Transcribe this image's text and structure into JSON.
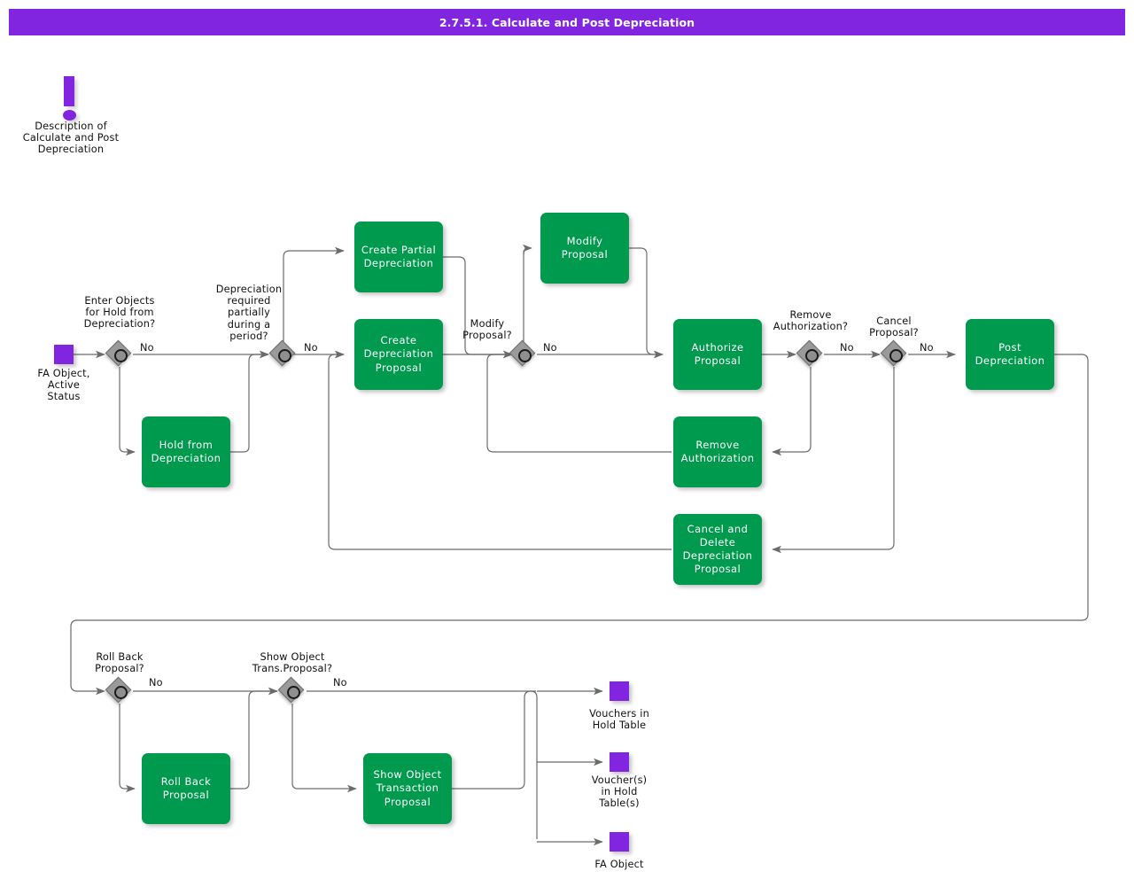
{
  "header": {
    "title": "2.7.5.1. Calculate and Post Depreciation"
  },
  "colors": {
    "accent_purple": "#8225e0",
    "task_green": "#009a4e",
    "gateway_gray": "#9a9a9a",
    "line_gray": "#6b6b6b",
    "text_white": "#ffffff",
    "text_dark": "#101010"
  },
  "annotation": {
    "icon": "exclamation-icon",
    "label": "Description of\nCalculate and Post\nDepreciation"
  },
  "events": {
    "start": {
      "label": "FA Object,\nActive\nStatus"
    },
    "end_vouchers_hold_table": {
      "label": "Vouchers in\nHold Table"
    },
    "end_vouchers_in_hold_tables": {
      "label": "Voucher(s)\nin Hold\nTable(s)"
    },
    "end_fa_object": {
      "label": "FA Object"
    }
  },
  "gateways": [
    {
      "id": "g1",
      "label": "Enter Objects\nfor Hold from\nDepreciation?",
      "branch_label": "No"
    },
    {
      "id": "g2",
      "label": "Depreciation\nrequired\npartially\nduring a\nperiod?",
      "branch_label": "No"
    },
    {
      "id": "g3",
      "label": "Modify\nProposal?",
      "branch_label": "No"
    },
    {
      "id": "g4",
      "label": "Remove\nAuthorization?",
      "branch_label": "No"
    },
    {
      "id": "g5",
      "label": "Cancel\nProposal?",
      "branch_label": "No"
    },
    {
      "id": "g6",
      "label": "Roll Back\nProposal?",
      "branch_label": "No"
    },
    {
      "id": "g7",
      "label": "Show Object\nTrans.Proposal?",
      "branch_label": "No"
    }
  ],
  "tasks": [
    {
      "id": "t_hold",
      "label": "Hold from\nDepreciation"
    },
    {
      "id": "t_create_partial",
      "label": "Create Partial\nDepreciation"
    },
    {
      "id": "t_create_prop",
      "label": "Create\nDepreciation\nProposal"
    },
    {
      "id": "t_modify",
      "label": "Modify Proposal"
    },
    {
      "id": "t_authorize",
      "label": "Authorize\nProposal"
    },
    {
      "id": "t_remove_auth",
      "label": "Remove\nAuthorization"
    },
    {
      "id": "t_cancel_delete",
      "label": "Cancel and\nDelete\nDepreciation\nProposal"
    },
    {
      "id": "t_post",
      "label": "Post\nDepreciation"
    },
    {
      "id": "t_rollback",
      "label": "Roll Back\nProposal"
    },
    {
      "id": "t_show_obj_trans",
      "label": "Show Object\nTransaction\nProposal"
    }
  ]
}
